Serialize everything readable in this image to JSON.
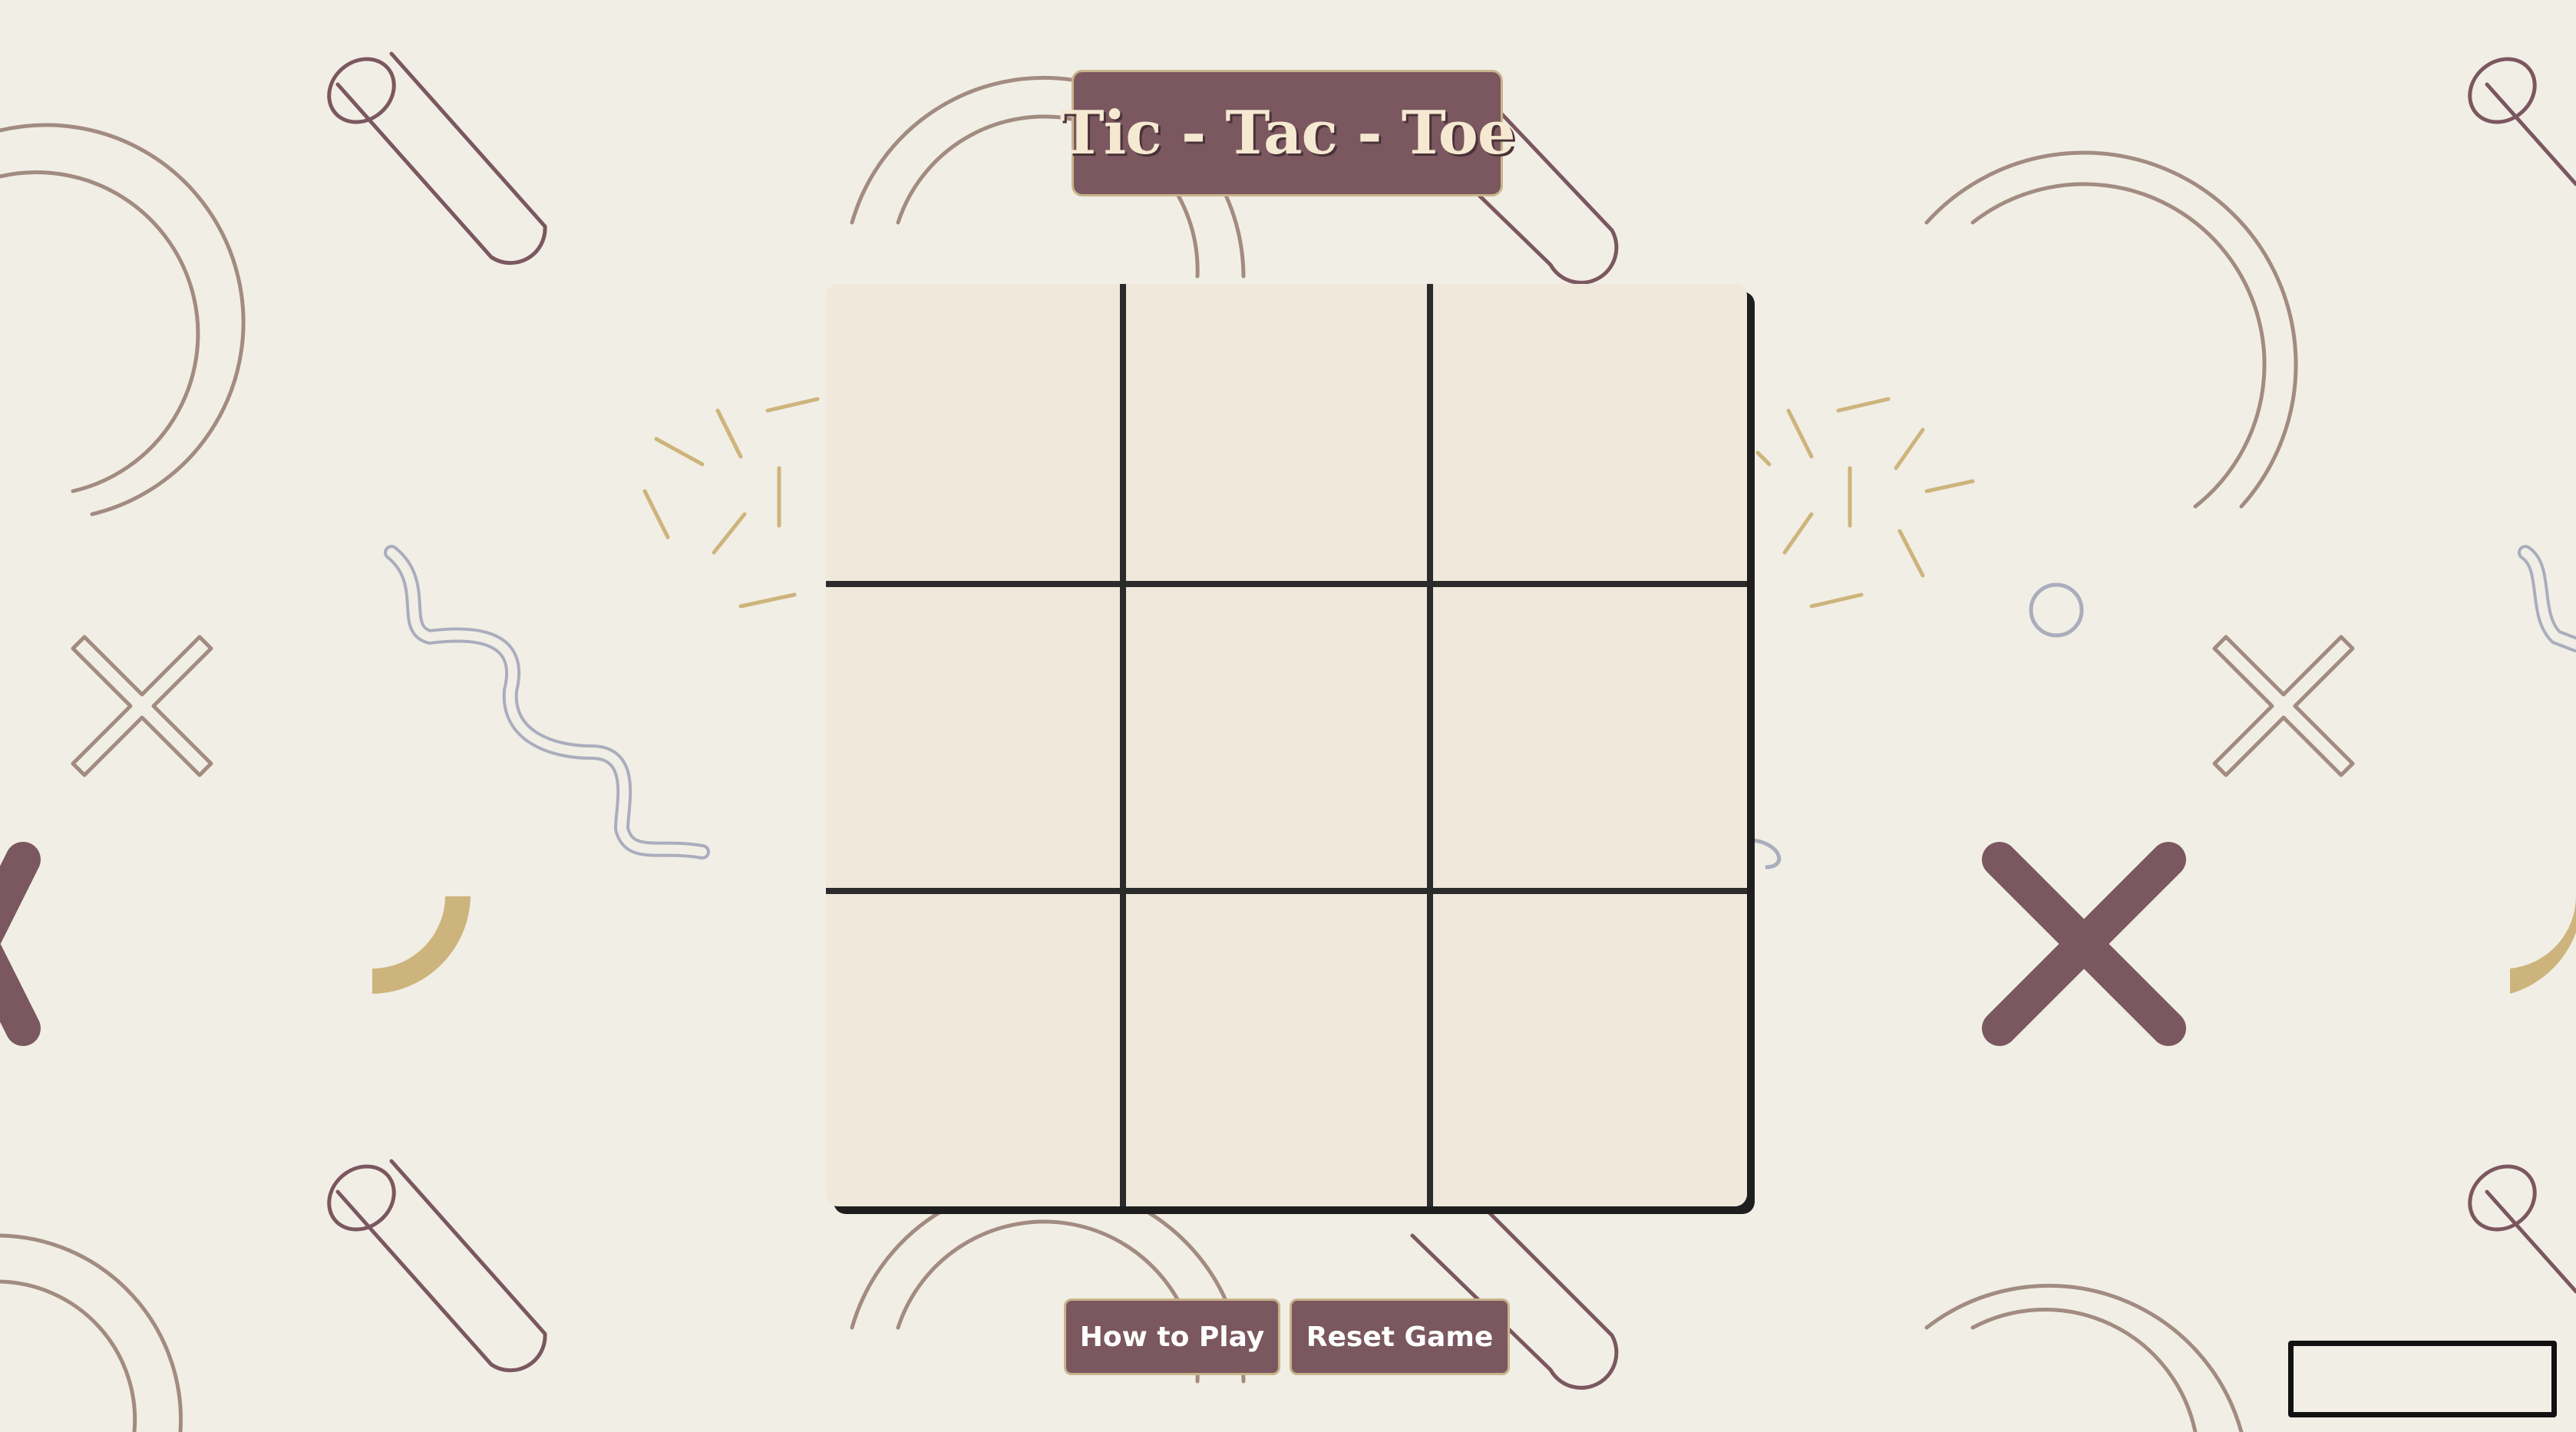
{
  "app": {
    "title": "Tic - Tac - Toe"
  },
  "board": {
    "cells": [
      {
        "id": "cell-1",
        "value": ""
      },
      {
        "id": "cell-2",
        "value": ""
      },
      {
        "id": "cell-3",
        "value": ""
      },
      {
        "id": "cell-4",
        "value": ""
      },
      {
        "id": "cell-5",
        "value": ""
      },
      {
        "id": "cell-6",
        "value": ""
      },
      {
        "id": "cell-7",
        "value": ""
      },
      {
        "id": "cell-8",
        "value": ""
      },
      {
        "id": "cell-9",
        "value": ""
      }
    ]
  },
  "controls": {
    "how_to_play_label": "How to Play",
    "reset_label": "Reset Game"
  },
  "colors": {
    "background": "#f1eee5",
    "accent": "#7b5760",
    "gold": "#c8b48a",
    "board": "#efe8db",
    "grid_lines": "#2b2b2b",
    "decor_blue": "#a9adbd",
    "decor_tan": "#a28b80",
    "decor_yellow": "#cdb47c"
  },
  "decorations": [
    "pipe-icon",
    "arc-icon",
    "x-outline-icon",
    "x-solid-icon",
    "squiggle-icon",
    "sparkle-icon",
    "circle-outline-icon",
    "half-circle-icon"
  ]
}
